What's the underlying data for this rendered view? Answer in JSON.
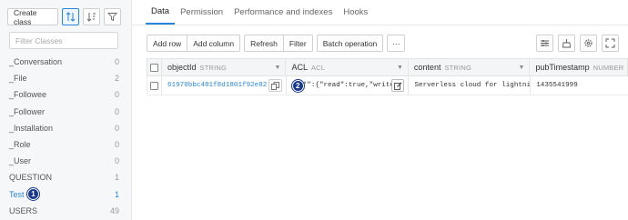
{
  "sidebar": {
    "create_class_label": "Create class",
    "filter_placeholder": "Filter Classes",
    "classes": [
      {
        "name": "_Conversation",
        "count": "0"
      },
      {
        "name": "_File",
        "count": "2"
      },
      {
        "name": "_Followee",
        "count": "0"
      },
      {
        "name": "_Follower",
        "count": "0"
      },
      {
        "name": "_Installation",
        "count": "0"
      },
      {
        "name": "_Role",
        "count": "0"
      },
      {
        "name": "_User",
        "count": "0"
      },
      {
        "name": "QUESTION",
        "count": "1"
      },
      {
        "name": "Test",
        "count": "1",
        "badge": "1"
      },
      {
        "name": "USERS",
        "count": "49"
      }
    ]
  },
  "tabs": [
    {
      "label": "Data"
    },
    {
      "label": "Permission"
    },
    {
      "label": "Performance and indexes"
    },
    {
      "label": "Hooks"
    }
  ],
  "toolbar": {
    "add_row": "Add row",
    "add_column": "Add column",
    "refresh": "Refresh",
    "filter": "Filter",
    "batch_operation": "Batch operation",
    "more": "···"
  },
  "table": {
    "columns": [
      {
        "name": "objectId",
        "type": "STRING"
      },
      {
        "name": "ACL",
        "type": "ACL"
      },
      {
        "name": "content",
        "type": "STRING"
      },
      {
        "name": "pubTimestamp",
        "type": "NUMBER"
      }
    ],
    "rows": [
      {
        "objectId": "61970bbc481f8d1801f92e82",
        "acl": "*\":{\"read\":true,\"write\"…",
        "content": "Serverless cloud for lightning-fast",
        "pubTimestamp": "1435541999",
        "badge": "2"
      }
    ]
  },
  "colors": {
    "accent": "#2a86d6",
    "badge": "#1b3a8a"
  }
}
